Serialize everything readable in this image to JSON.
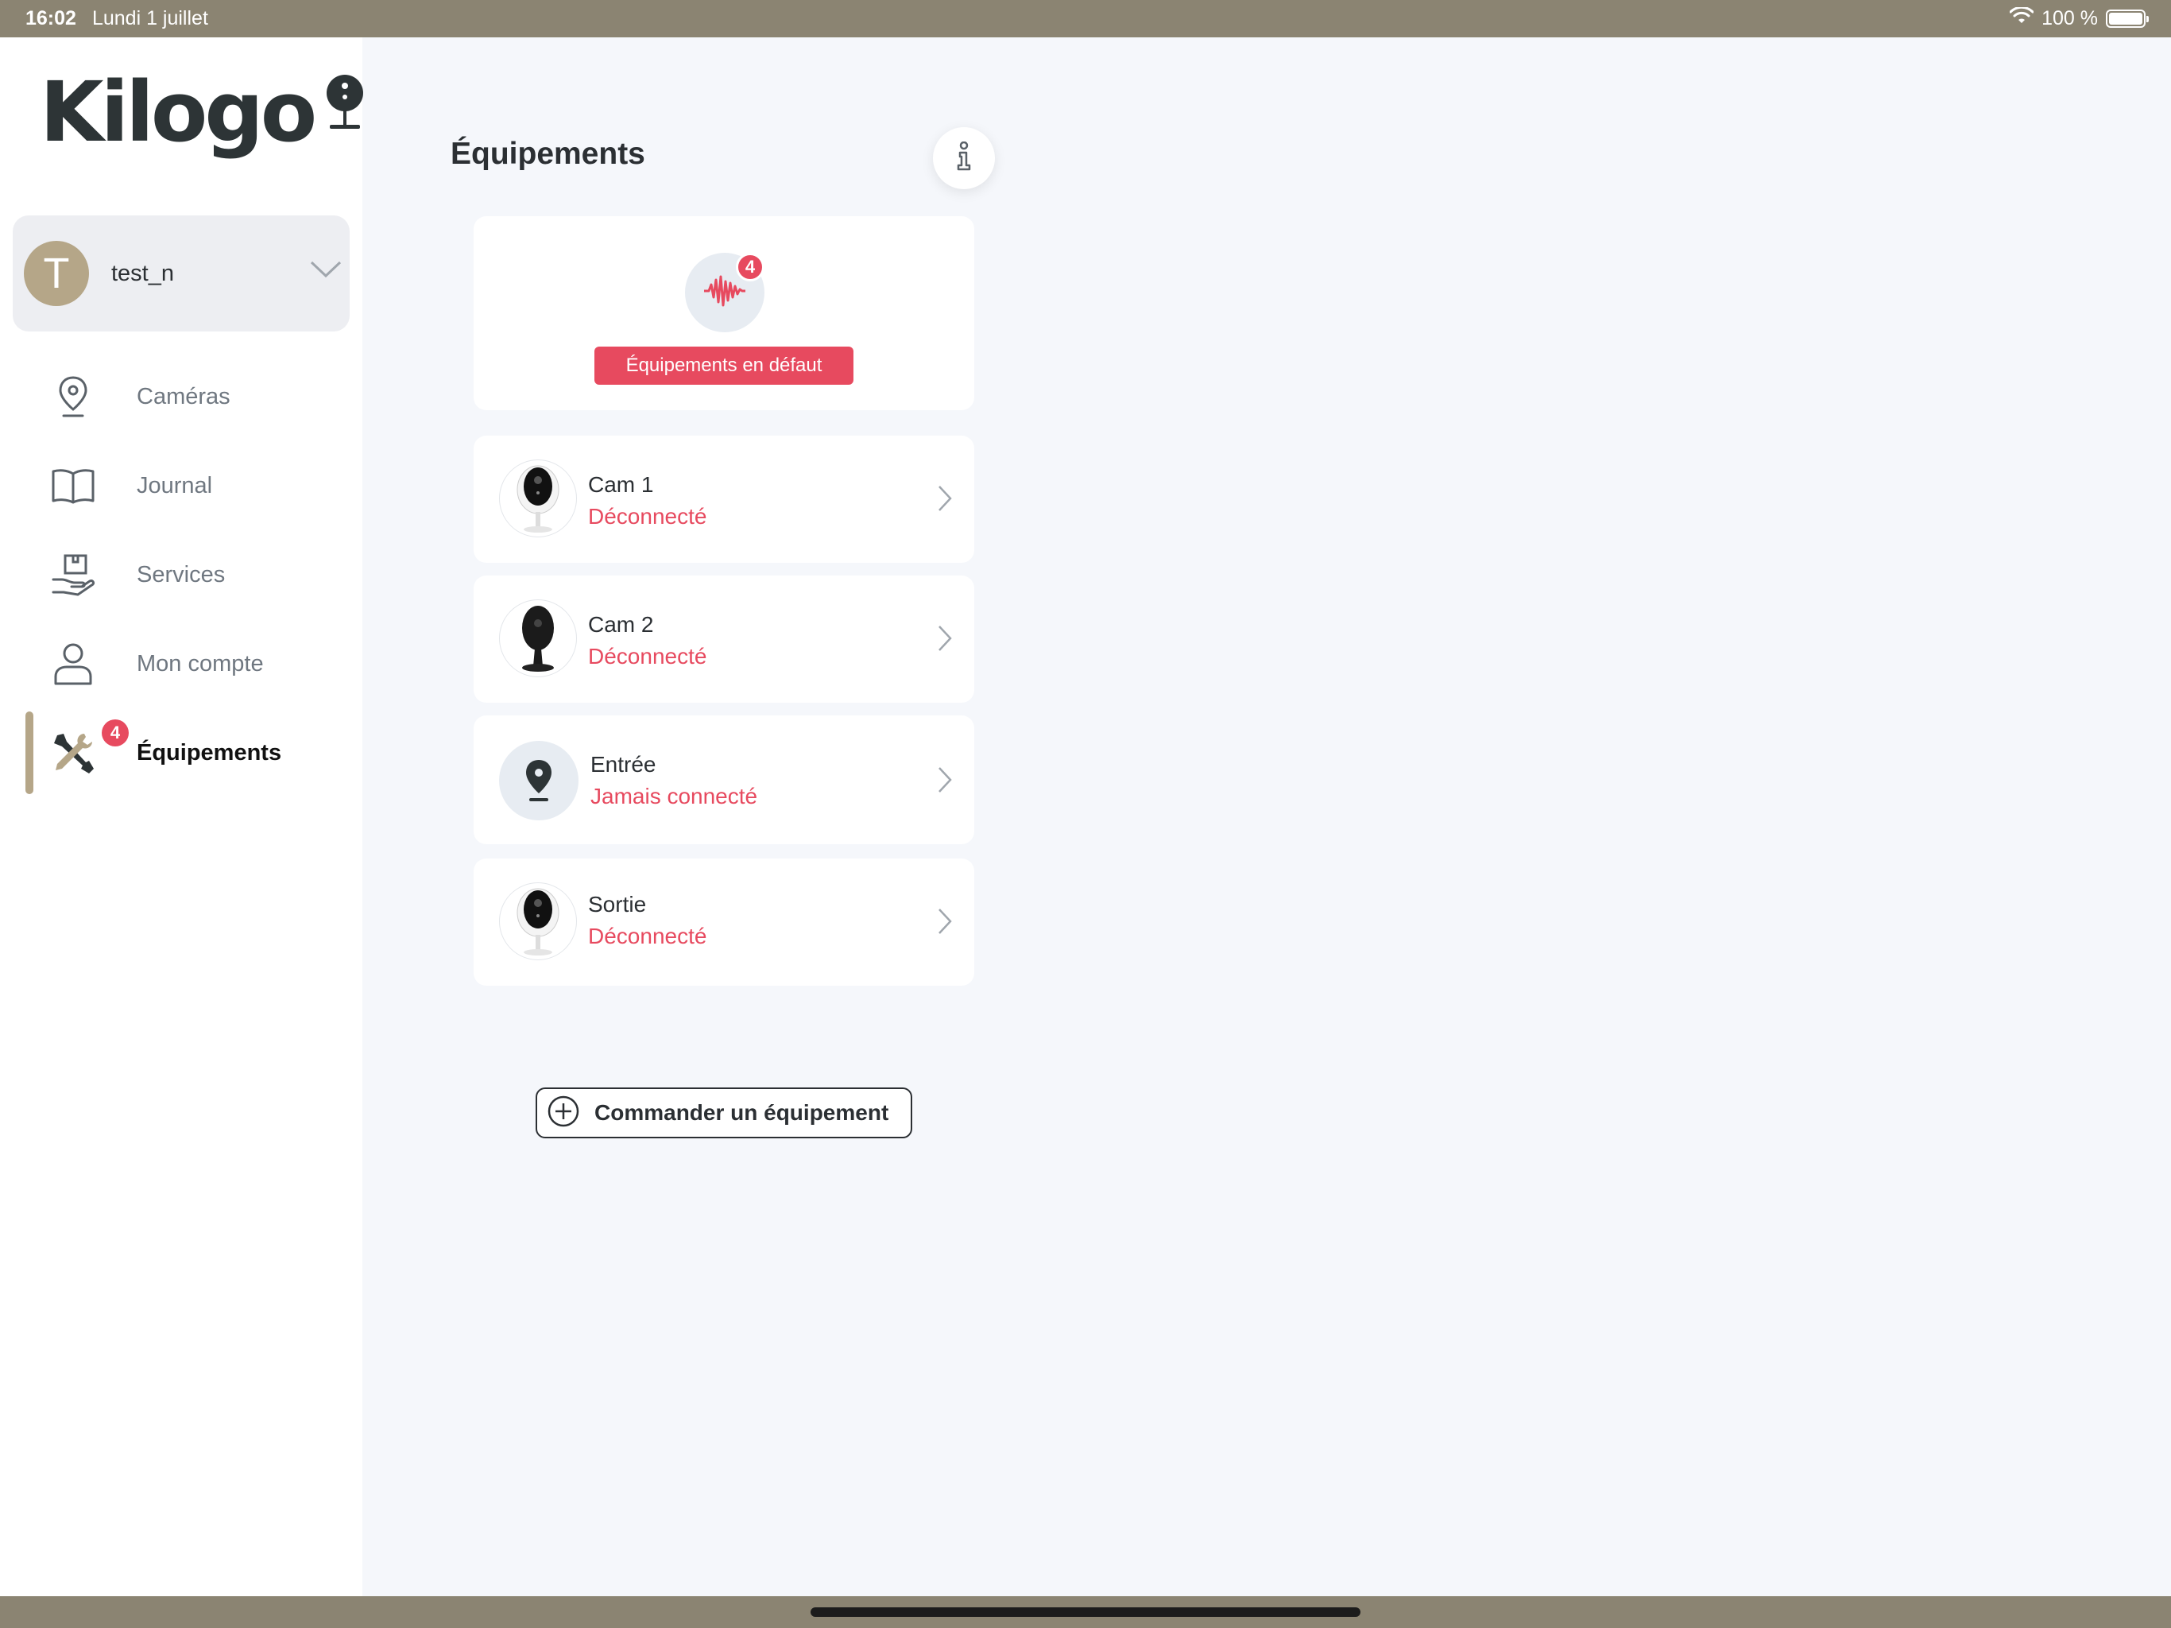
{
  "status_bar": {
    "time": "16:02",
    "date": "Lundi 1 juillet",
    "battery": "100 %",
    "battery_level": 1.0
  },
  "sidebar": {
    "logo_text": "Kilogo",
    "account": {
      "initial": "T",
      "name": "test_n"
    },
    "items": [
      {
        "label": "Caméras",
        "icon": "location-pin-icon"
      },
      {
        "label": "Journal",
        "icon": "book-icon"
      },
      {
        "label": "Services",
        "icon": "hand-package-icon"
      },
      {
        "label": "Mon compte",
        "icon": "user-icon"
      },
      {
        "label": "Équipements",
        "icon": "tools-icon",
        "badge": "4",
        "active": true
      }
    ]
  },
  "main": {
    "title": "Équipements",
    "alert": {
      "badge": "4",
      "label": "Équipements en défaut",
      "icon": "sound-wave-icon"
    },
    "devices": [
      {
        "name": "Cam 1",
        "status": "Déconnecté",
        "thumb": "white-camera"
      },
      {
        "name": "Cam 2",
        "status": "Déconnecté",
        "thumb": "black-camera"
      },
      {
        "name": "Entrée",
        "status": "Jamais connecté",
        "thumb": "pin-camera"
      },
      {
        "name": "Sortie",
        "status": "Déconnecté",
        "thumb": "white-camera"
      }
    ],
    "order_button": "Commander un équipement"
  },
  "colors": {
    "accent": "#b5a688",
    "alert": "#e74a5f",
    "status_bar": "#8b8472",
    "background": "#f5f7fb"
  }
}
